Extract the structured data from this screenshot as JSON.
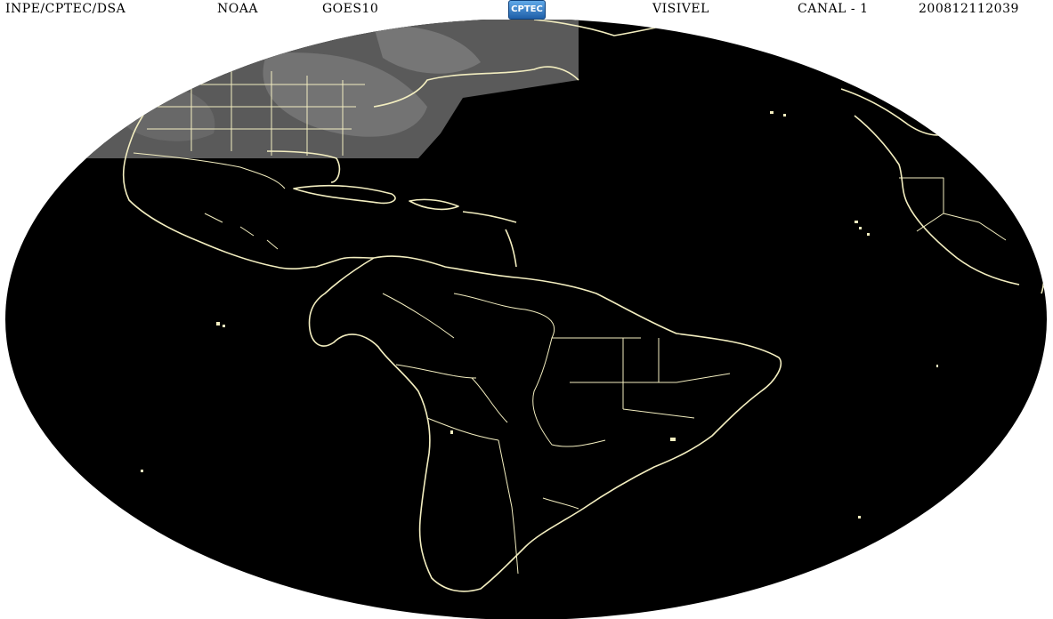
{
  "header": {
    "source": "INPE/CPTEC/DSA",
    "agency": "NOAA",
    "satellite": "GOES10",
    "logo_text": "CPTEC",
    "band": "VISIVEL",
    "channel": "CANAL - 1",
    "timestamp": "200812112039"
  },
  "map": {
    "projection": "ellipse",
    "background_color": "#ffffff",
    "disk_color": "#000000",
    "border_color": "#f3eec0",
    "daylight_color": "#6e6e6e"
  }
}
